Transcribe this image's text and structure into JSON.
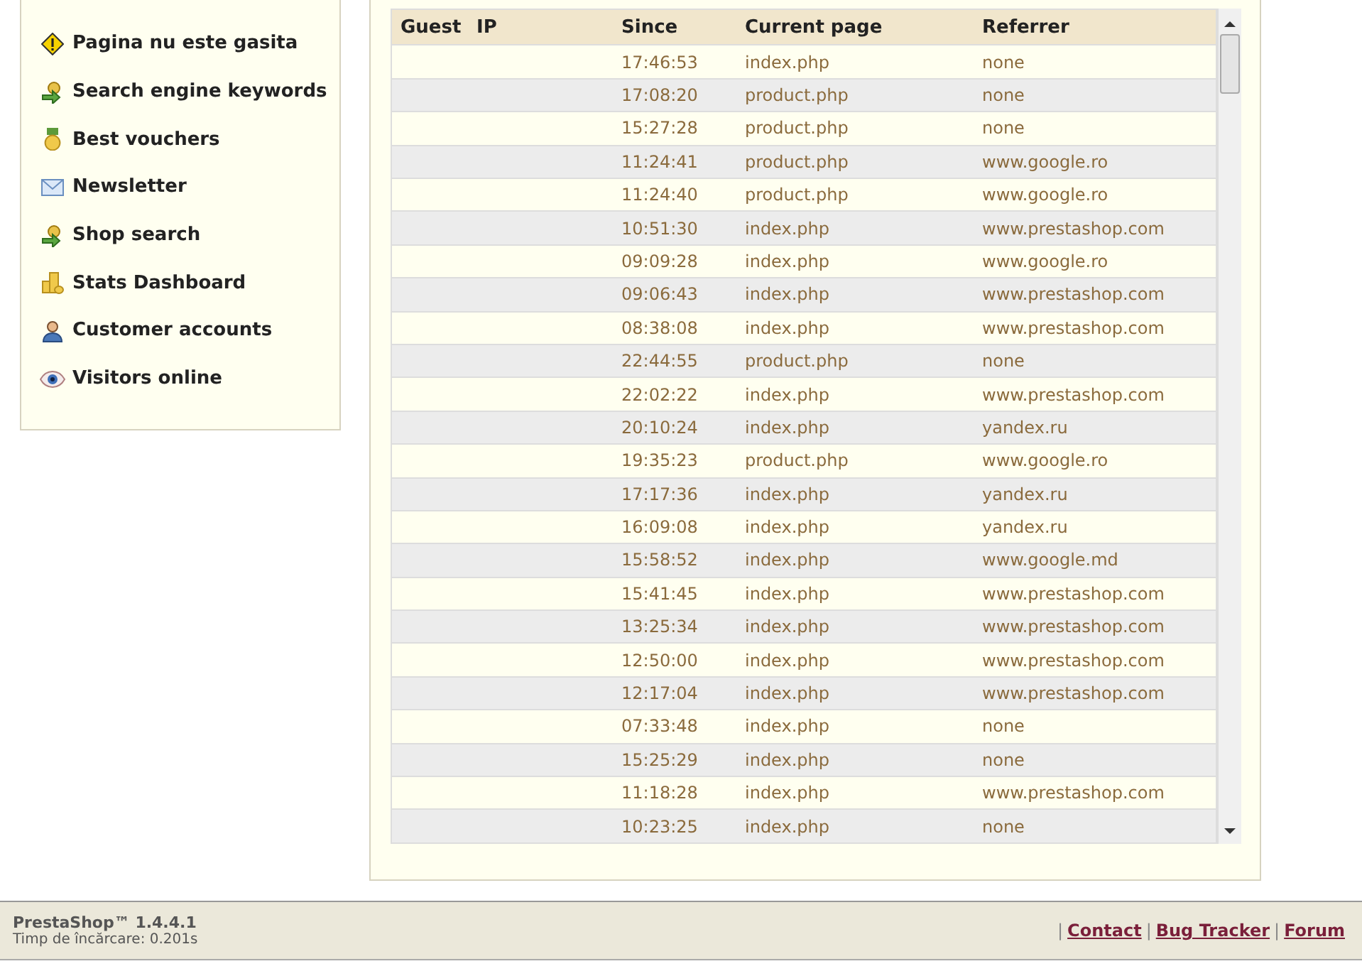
{
  "sidebar": {
    "items": [
      {
        "label": "Pagina nu este gasita",
        "kind": "warning"
      },
      {
        "label": "Search engine keywords",
        "kind": "keys"
      },
      {
        "label": "Best vouchers",
        "kind": "medal"
      },
      {
        "label": "Newsletter",
        "kind": "mail"
      },
      {
        "label": "Shop search",
        "kind": "keys"
      },
      {
        "label": "Stats Dashboard",
        "kind": "coins"
      },
      {
        "label": "Customer accounts",
        "kind": "user"
      },
      {
        "label": "Visitors online",
        "kind": "eye"
      }
    ]
  },
  "table": {
    "columns": [
      "Guest",
      "IP",
      "Since",
      "Current page",
      "Referrer"
    ],
    "rows": [
      {
        "since": "17:46:53",
        "page": "index.php",
        "referrer": "none"
      },
      {
        "since": "17:08:20",
        "page": "product.php",
        "referrer": "none"
      },
      {
        "since": "15:27:28",
        "page": "product.php",
        "referrer": "none"
      },
      {
        "since": "11:24:41",
        "page": "product.php",
        "referrer": "www.google.ro"
      },
      {
        "since": "11:24:40",
        "page": "product.php",
        "referrer": "www.google.ro"
      },
      {
        "since": "10:51:30",
        "page": "index.php",
        "referrer": "www.prestashop.com"
      },
      {
        "since": "09:09:28",
        "page": "index.php",
        "referrer": "www.google.ro"
      },
      {
        "since": "09:06:43",
        "page": "index.php",
        "referrer": "www.prestashop.com"
      },
      {
        "since": "08:38:08",
        "page": "index.php",
        "referrer": "www.prestashop.com"
      },
      {
        "since": "22:44:55",
        "page": "product.php",
        "referrer": "none"
      },
      {
        "since": "22:02:22",
        "page": "index.php",
        "referrer": "www.prestashop.com"
      },
      {
        "since": "20:10:24",
        "page": "index.php",
        "referrer": "yandex.ru"
      },
      {
        "since": "19:35:23",
        "page": "product.php",
        "referrer": "www.google.ro"
      },
      {
        "since": "17:17:36",
        "page": "index.php",
        "referrer": "yandex.ru"
      },
      {
        "since": "16:09:08",
        "page": "index.php",
        "referrer": "yandex.ru"
      },
      {
        "since": "15:58:52",
        "page": "index.php",
        "referrer": "www.google.md"
      },
      {
        "since": "15:41:45",
        "page": "index.php",
        "referrer": "www.prestashop.com"
      },
      {
        "since": "13:25:34",
        "page": "index.php",
        "referrer": "www.prestashop.com"
      },
      {
        "since": "12:50:00",
        "page": "index.php",
        "referrer": "www.prestashop.com"
      },
      {
        "since": "12:17:04",
        "page": "index.php",
        "referrer": "www.prestashop.com"
      },
      {
        "since": "07:33:48",
        "page": "index.php",
        "referrer": "none"
      },
      {
        "since": "15:25:29",
        "page": "index.php",
        "referrer": "none"
      },
      {
        "since": "11:18:28",
        "page": "index.php",
        "referrer": "www.prestashop.com"
      },
      {
        "since": "10:23:25",
        "page": "index.php",
        "referrer": "none"
      }
    ]
  },
  "footer": {
    "product": "PrestaShop™ 1.4.4.1",
    "load_time": "Timp de încărcare: 0.201s",
    "separator": "|",
    "links": [
      "Contact",
      "Bug Tracker",
      "Forum"
    ]
  }
}
